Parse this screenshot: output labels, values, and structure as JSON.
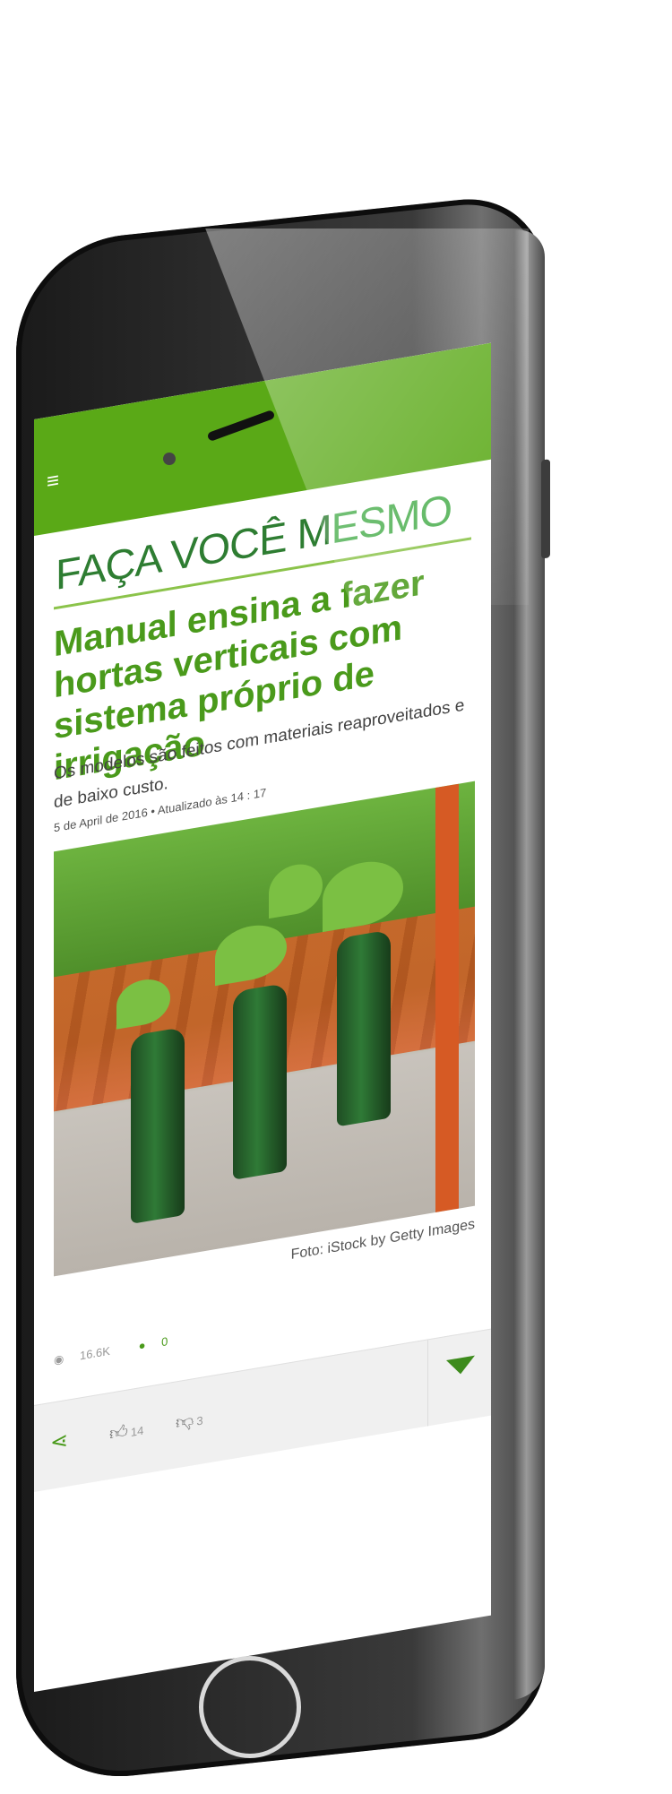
{
  "app": {
    "section_title_main": "FAÇA VOCÊ M",
    "section_title_rest": "ESMO",
    "menu_icon": "hamburger-icon"
  },
  "article": {
    "headline": "Manual ensina a fazer hortas verticais com sistema próprio de irrigação",
    "subheadline": "Os modelos são feitos com materiais reaproveitados e de baixo custo.",
    "dateline": "5 de April de 2016 • Atualizado às 14 : 17",
    "photo_caption": "Foto: iStock by Getty Images"
  },
  "stats": {
    "views": "16.6K",
    "comments": "0",
    "views_icon": "eye-icon",
    "comments_icon": "comment-icon"
  },
  "actions": {
    "share_icon": "share-icon",
    "likes": "14",
    "dislikes": "3",
    "like_icon": "thumbs-up-icon",
    "dislike_icon": "thumbs-down-icon",
    "expand_icon": "triangle-down-icon"
  },
  "colors": {
    "brand_green": "#5aa917",
    "headline_green": "#4a9a1b",
    "title_dark_green": "#2e7d32"
  }
}
